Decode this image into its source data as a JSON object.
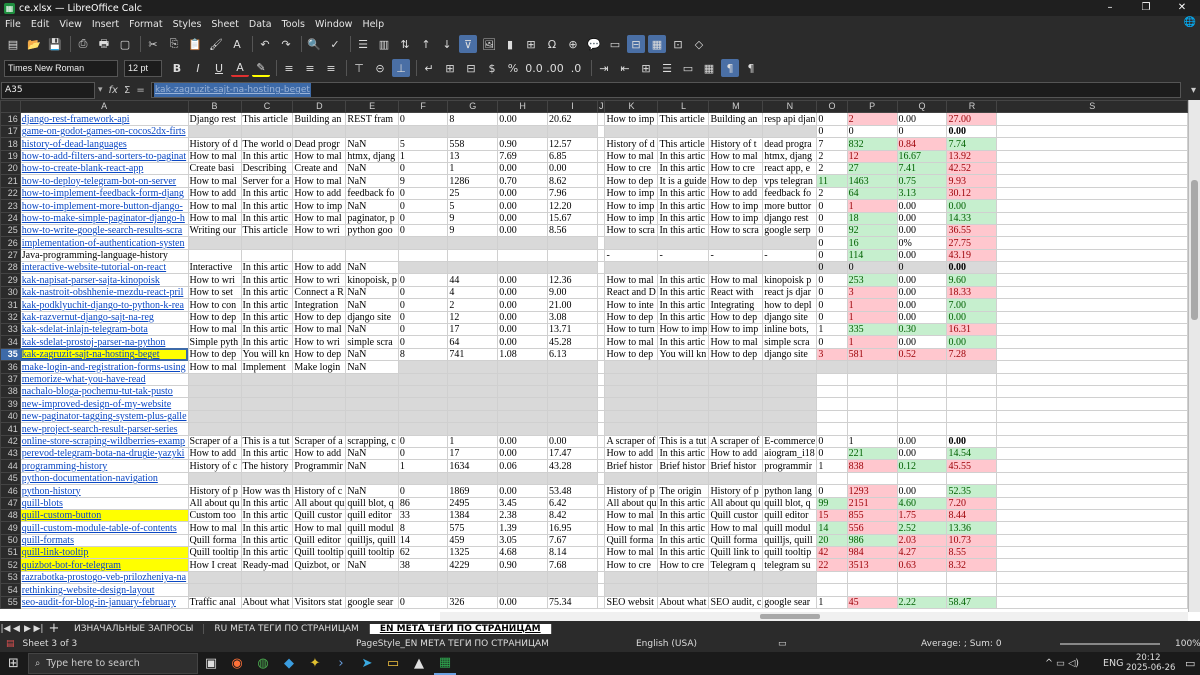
{
  "window": {
    "title": "ce.xlsx — LibreOffice Calc",
    "app_icon": "calc-icon",
    "controls": [
      "–",
      "❐",
      "✕"
    ]
  },
  "menu": [
    "File",
    "Edit",
    "View",
    "Insert",
    "Format",
    "Styles",
    "Sheet",
    "Data",
    "Tools",
    "Window",
    "Help"
  ],
  "formatting": {
    "font_name": "Times New Roman",
    "font_size": "12 pt"
  },
  "formula": {
    "name_box": "A35",
    "content": "kak-zagruzit-sajt-na-hosting-beget",
    "fx": "fx",
    "sum": "Σ",
    "eq": "="
  },
  "columns": [
    "A",
    "B",
    "C",
    "D",
    "E",
    "F",
    "G",
    "H",
    "I",
    "J",
    "K",
    "L",
    "M",
    "N",
    "O",
    "P",
    "Q",
    "R",
    "S"
  ],
  "selected_row": "35",
  "rows": [
    {
      "n": "16",
      "A": "django-rest-framework-api",
      "B": "Django rest",
      "C": "This article",
      "D": "Building an",
      "E": "REST fram",
      "F": "0",
      "G": "8",
      "H": "0.00",
      "I": "20.62",
      "K": "How to imp",
      "L": "This article",
      "M": "Building an",
      "N": "resp api djan",
      "O": "0",
      "P": "2",
      "Q": "0.00",
      "R": "27.00",
      "Pc": "pink",
      "Rc": "pink"
    },
    {
      "n": "17",
      "A": "game-on-godot-games-on-cocos2dx-firts",
      "grey": true,
      "O": "0",
      "P": "0",
      "Q": "0",
      "R": "0.00",
      "Rc": "bold"
    },
    {
      "n": "18",
      "A": "history-of-dead-languages",
      "B": "History of d",
      "C": "The world o",
      "D": "Dead progr",
      "E": "NaN",
      "F": "5",
      "G": "558",
      "H": "0.90",
      "I": "12.57",
      "K": "History of d",
      "L": "This article",
      "M": "History of t",
      "N": "dead progra",
      "O": "7",
      "P": "832",
      "Q": "0.84",
      "R": "7.74",
      "Pc": "green",
      "Qc": "pink",
      "Rc": "green"
    },
    {
      "n": "19",
      "A": "how-to-add-filters-and-sorters-to-paginat",
      "B": "How to mal",
      "C": "In this artic",
      "D": "How to mal",
      "E": "htmx, djang",
      "F": "1",
      "G": "13",
      "H": "7.69",
      "I": "6.85",
      "K": "How to mal",
      "L": "In this artic",
      "M": "How to mal",
      "N": "htmx, djang",
      "O": "2",
      "P": "12",
      "Q": "16.67",
      "R": "13.92",
      "Pc": "pink",
      "Qc": "green",
      "Rc": "pink"
    },
    {
      "n": "20",
      "A": "how-to-create-blank-react-app",
      "B": "Create basi",
      "C": "Describing",
      "D": "Create and",
      "E": "NaN",
      "F": "0",
      "G": "1",
      "H": "0.00",
      "I": "0.00",
      "K": "How to cre",
      "L": "In this artic",
      "M": "How to cre",
      "N": "react app, e",
      "O": "2",
      "P": "27",
      "Q": "7.41",
      "R": "42.52",
      "Pc": "green",
      "Qc": "green",
      "Rc": "pink"
    },
    {
      "n": "21",
      "A": "how-to-deploy-telegram-bot-on-server",
      "B": "How to mal",
      "C": "Server for a",
      "D": "How to mal",
      "E": "NaN",
      "F": "9",
      "G": "1286",
      "H": "0.70",
      "I": "8.62",
      "K": "How to dep",
      "L": "It is a guide",
      "M": "How to dep",
      "N": "vps telegran",
      "O": "11",
      "P": "1463",
      "Q": "0.75",
      "R": "9.93",
      "Oc": "green",
      "Pc": "green",
      "Qc": "green",
      "Rc": "pink"
    },
    {
      "n": "22",
      "A": "how-to-implement-feedback-form-djang",
      "B": "How to add",
      "C": "In this artic",
      "D": "How to add",
      "E": "feedback fo",
      "F": "0",
      "G": "25",
      "H": "0.00",
      "I": "7.96",
      "K": "How to imp",
      "L": "In this artic",
      "M": "How to add",
      "N": "feedback fo",
      "O": "2",
      "P": "64",
      "Q": "3.13",
      "R": "30.12",
      "Pc": "green",
      "Qc": "green",
      "Rc": "pink"
    },
    {
      "n": "23",
      "A": "how-to-implement-more-button-django-",
      "B": "How to mal",
      "C": "In this artic",
      "D": "How to imp",
      "E": "NaN",
      "F": "0",
      "G": "5",
      "H": "0.00",
      "I": "12.20",
      "K": "How to imp",
      "L": "In this artic",
      "M": "How to imp",
      "N": "more buttor",
      "O": "0",
      "P": "1",
      "Q": "0.00",
      "R": "0.00",
      "Pc": "pink",
      "Rc": "green"
    },
    {
      "n": "24",
      "A": "how-to-make-simple-paginator-django-h",
      "B": "How to mal",
      "C": "In this artic",
      "D": "How to mal",
      "E": "paginator, p",
      "F": "0",
      "G": "9",
      "H": "0.00",
      "I": "15.67",
      "K": "How to imp",
      "L": "In this artic",
      "M": "How to imp",
      "N": "django rest",
      "O": "0",
      "P": "18",
      "Q": "0.00",
      "R": "14.33",
      "Pc": "green",
      "Rc": "green"
    },
    {
      "n": "25",
      "A": "how-to-write-google-search-results-scra",
      "B": "Writing our",
      "C": "This article",
      "D": "How to wri",
      "E": "python goo",
      "F": "0",
      "G": "9",
      "H": "0.00",
      "I": "8.56",
      "K": "How to scra",
      "L": "In this artic",
      "M": "How to scra",
      "N": "google serp",
      "O": "0",
      "P": "92",
      "Q": "0.00",
      "R": "36.55",
      "Pc": "green",
      "Rc": "pink"
    },
    {
      "n": "26",
      "A": "implementation-of-authentication-systen",
      "grey": true,
      "O": "0",
      "P": "16",
      "Q": "0%",
      "R": "27.75",
      "Pc": "green",
      "Rc": "pink"
    },
    {
      "n": "27",
      "A": "Java-programming-language-history",
      "plain": true,
      "K": "-",
      "L": "-",
      "M": "-",
      "N": "-",
      "O": "0",
      "P": "114",
      "Q": "0.00",
      "R": "43.19",
      "Pc": "green",
      "Rc": "pink"
    },
    {
      "n": "28",
      "A": "interactive-website-tutorial-on-react",
      "B": "Interactive",
      "C": "In this artic",
      "D": "How to add",
      "E": "NaN",
      "grey2": true,
      "O": "0",
      "P": "0",
      "Q": "0",
      "R": "0.00",
      "Rc": "bold"
    },
    {
      "n": "29",
      "A": "kak-napisat-parser-sajta-kinopoisk",
      "B": "How to wri",
      "C": "In this artic",
      "D": "How to wri",
      "E": "kinopoisk, p",
      "F": "0",
      "G": "44",
      "H": "0.00",
      "I": "12.36",
      "K": "How to mal",
      "L": "In this artic",
      "M": "How to mal",
      "N": "kinopoisk p",
      "O": "0",
      "P": "253",
      "Q": "0.00",
      "R": "9.60",
      "Pc": "green",
      "Rc": "green"
    },
    {
      "n": "30",
      "A": "kak-nastroit-obshhenie-mezdu-react-pril",
      "B": "How to set",
      "C": "In this artic",
      "D": "Connect a R",
      "E": "NaN",
      "F": "0",
      "G": "4",
      "H": "0.00",
      "I": "9.00",
      "K": "React and D",
      "L": "In this artic",
      "M": "React with",
      "N": "react js djar",
      "O": "0",
      "P": "3",
      "Q": "0.00",
      "R": "18.33",
      "Pc": "pink",
      "Rc": "pink"
    },
    {
      "n": "31",
      "A": "kak-podklyuchit-django-to-python-k-rea",
      "B": "How to con",
      "C": "In this artic",
      "D": "Integration",
      "E": "NaN",
      "F": "0",
      "G": "2",
      "H": "0.00",
      "I": "21.00",
      "K": "How to inte",
      "L": "In this artic",
      "M": "Integrating",
      "N": "how to depl",
      "O": "0",
      "P": "1",
      "Q": "0.00",
      "R": "7.00",
      "Pc": "pink",
      "Rc": "green"
    },
    {
      "n": "32",
      "A": "kak-razvernut-django-sajt-na-reg",
      "B": "How to dep",
      "C": "In this artic",
      "D": "How to dep",
      "E": "django site",
      "F": "0",
      "G": "12",
      "H": "0.00",
      "I": "3.08",
      "K": "How to dep",
      "L": "In this artic",
      "M": "How to dep",
      "N": "django site",
      "O": "0",
      "P": "1",
      "Q": "0.00",
      "R": "0.00",
      "Pc": "pink",
      "Rc": "green"
    },
    {
      "n": "33",
      "A": "kak-sdelat-inlajn-telegram-bota",
      "B": "How to mal",
      "C": "In this artic",
      "D": "How to mal",
      "E": "NaN",
      "F": "0",
      "G": "17",
      "H": "0.00",
      "I": "13.71",
      "K": "How to turn",
      "L": "How to imp",
      "M": "How to imp",
      "N": "inline bots,",
      "O": "1",
      "P": "335",
      "Q": "0.30",
      "R": "16.31",
      "Pc": "green",
      "Qc": "green",
      "Rc": "pink"
    },
    {
      "n": "34",
      "A": "kak-sdelat-prostoj-parser-na-python",
      "B": "Simple pyth",
      "C": "In this artic",
      "D": "How to wri",
      "E": "simple scra",
      "F": "0",
      "G": "64",
      "H": "0.00",
      "I": "45.28",
      "K": "How to mal",
      "L": "In this artic",
      "M": "How to mal",
      "N": "simple scra",
      "O": "0",
      "P": "1",
      "Q": "0.00",
      "R": "0.00",
      "Pc": "pink",
      "Rc": "green"
    },
    {
      "n": "35",
      "A": "kak-zagruzit-sajt-na-hosting-beget",
      "yel": true,
      "B": "How to dep",
      "C": "You will kn",
      "D": "How to dep",
      "E": "NaN",
      "F": "8",
      "G": "741",
      "H": "1.08",
      "I": "6.13",
      "K": "How to dep",
      "L": "You will kn",
      "M": "How to dep",
      "N": "django site",
      "O": "3",
      "P": "581",
      "Q": "0.52",
      "R": "7.28",
      "Oc": "pink",
      "Pc": "pink",
      "Qc": "pink",
      "Rc": "pink"
    },
    {
      "n": "36",
      "A": "make-login-and-registration-forms-using",
      "B": "How to mal",
      "C": "Implement",
      "D": "Make login",
      "E": "NaN",
      "grey2": true
    },
    {
      "n": "37",
      "A": "memorize-what-you-have-read",
      "grey": true
    },
    {
      "n": "38",
      "A": "nachalo-bloga-pochemu-tut-tak-pusto",
      "grey": true
    },
    {
      "n": "39",
      "A": "new-improved-design-of-my-website",
      "grey": true
    },
    {
      "n": "40",
      "A": "new-paginator-tagging-system-plus-galle",
      "grey": true
    },
    {
      "n": "41",
      "A": "new-project-search-result-parser-series",
      "grey": true
    },
    {
      "n": "42",
      "A": "online-store-scraping-wildberries-examp",
      "B": "Scraper of a",
      "C": "This is a tut",
      "D": "Scraper of a",
      "E": "scrapping, c",
      "F": "0",
      "G": "1",
      "H": "0.00",
      "I": "0.00",
      "K": "A scraper of",
      "L": "This is a tut",
      "M": "A scraper of",
      "N": "E-commerce",
      "O": "0",
      "P": "1",
      "Q": "0.00",
      "R": "0.00",
      "Rc": "bold"
    },
    {
      "n": "43",
      "A": "perevod-telegram-bota-na-drugie-yazyki",
      "B": "How to add",
      "C": "In this artic",
      "D": "How to add",
      "E": "NaN",
      "F": "0",
      "G": "17",
      "H": "0.00",
      "I": "17.47",
      "K": "How to add",
      "L": "In this artic",
      "M": "How to add",
      "N": "aiogram_i18",
      "O": "0",
      "P": "221",
      "Q": "0.00",
      "R": "14.54",
      "Pc": "green",
      "Rc": "green"
    },
    {
      "n": "44",
      "A": "programming-history",
      "B": "History of c",
      "C": "The history",
      "D": "Programmir",
      "E": "NaN",
      "F": "1",
      "G": "1634",
      "H": "0.06",
      "I": "43.28",
      "K": "Brief histor",
      "L": "Brief histor",
      "M": "Brief histor",
      "N": "programmir",
      "O": "1",
      "P": "838",
      "Q": "0.12",
      "R": "45.55",
      "Pc": "pink",
      "Qc": "green",
      "Rc": "pink"
    },
    {
      "n": "45",
      "A": "python-documentation-navigation",
      "grey": true
    },
    {
      "n": "46",
      "A": "python-history",
      "B": "History of p",
      "C": "How was th",
      "D": "History of c",
      "E": "NaN",
      "F": "0",
      "G": "1869",
      "H": "0.00",
      "I": "53.48",
      "K": "History of p",
      "L": "The origin",
      "M": "History of p",
      "N": "python lang",
      "O": "0",
      "P": "1293",
      "Q": "0.00",
      "R": "52.35",
      "Pc": "pink",
      "Rc": "green"
    },
    {
      "n": "47",
      "A": "quill-blots",
      "B": "All about qu",
      "C": "In this artic",
      "D": "All about qu",
      "E": "quill blot, q",
      "F": "86",
      "G": "2495",
      "H": "3.45",
      "I": "6.42",
      "K": "All about qu",
      "L": "In this artic",
      "M": "All about qu",
      "N": "quill blot, q",
      "O": "99",
      "P": "2151",
      "Q": "4.60",
      "R": "7.20",
      "Oc": "green",
      "Pc": "pink",
      "Qc": "green",
      "Rc": "pink"
    },
    {
      "n": "48",
      "A": "quill-custom-button",
      "yel": true,
      "B": "Custom too",
      "C": "In this artic",
      "D": "Quill custor",
      "E": "quill editor",
      "F": "33",
      "G": "1384",
      "H": "2.38",
      "I": "8.42",
      "K": "How to mal",
      "L": "In this artic",
      "M": "Quill custor",
      "N": "quill editor",
      "O": "15",
      "P": "855",
      "Q": "1.75",
      "R": "8.44",
      "Oc": "pink",
      "Pc": "pink",
      "Qc": "pink",
      "Rc": "pink"
    },
    {
      "n": "49",
      "A": "quill-custom-module-table-of-contents",
      "B": "How to mal",
      "C": "In this artic",
      "D": "How to mal",
      "E": "quill modul",
      "F": "8",
      "G": "575",
      "H": "1.39",
      "I": "16.95",
      "K": "How to mal",
      "L": "In this artic",
      "M": "How to mal",
      "N": "quill modul",
      "O": "14",
      "P": "556",
      "Q": "2.52",
      "R": "13.36",
      "Oc": "green",
      "Pc": "pink",
      "Qc": "green",
      "Rc": "green"
    },
    {
      "n": "50",
      "A": "quill-formats",
      "B": "Quill forma",
      "C": "In this artic",
      "D": "Quill editor",
      "E": "quilljs, quill",
      "F": "14",
      "G": "459",
      "H": "3.05",
      "I": "7.67",
      "K": "Quill forma",
      "L": "In this artic",
      "M": "Quill forma",
      "N": "quilljs, quill",
      "O": "20",
      "P": "986",
      "Q": "2.03",
      "R": "10.73",
      "Oc": "green",
      "Pc": "green",
      "Qc": "pink",
      "Rc": "pink"
    },
    {
      "n": "51",
      "A": "quill-link-tooltip",
      "yel": true,
      "B": "Quill tooltip",
      "C": "In this artic",
      "D": "Quill tooltip",
      "E": "quill tooltip",
      "F": "62",
      "G": "1325",
      "H": "4.68",
      "I": "8.14",
      "K": "How to mal",
      "L": "In this artic",
      "M": "Quill link to",
      "N": "quill tooltip",
      "O": "42",
      "P": "984",
      "Q": "4.27",
      "R": "8.55",
      "Oc": "pink",
      "Pc": "pink",
      "Qc": "pink",
      "Rc": "pink"
    },
    {
      "n": "52",
      "A": "quizbot-bot-for-telegram",
      "yel": true,
      "B": "How I creat",
      "C": "Ready-mad",
      "D": "Quizbot, or",
      "E": "NaN",
      "F": "38",
      "G": "4229",
      "H": "0.90",
      "I": "7.68",
      "K": "How to cre",
      "L": "How to cre",
      "M": "Telegram q",
      "N": "telegram su",
      "O": "22",
      "P": "3513",
      "Q": "0.63",
      "R": "8.32",
      "Oc": "pink",
      "Pc": "pink",
      "Qc": "pink",
      "Rc": "pink"
    },
    {
      "n": "53",
      "A": "razrabotka-prostogo-veb-prilozheniya-na",
      "grey": true
    },
    {
      "n": "54",
      "A": "rethinking-website-design-layout",
      "grey": true
    },
    {
      "n": "55",
      "A": "seo-audit-for-blog-in-january-february",
      "B": "Traffic anal",
      "C": "About what",
      "D": "Visitors stat",
      "E": "google sear",
      "F": "0",
      "G": "326",
      "H": "0.00",
      "I": "75.34",
      "K": "SEO websit",
      "L": "About what",
      "M": "SEO audit, c",
      "N": "google sear",
      "O": "1",
      "P": "45",
      "Q": "2.22",
      "R": "58.47",
      "Pc": "pink",
      "Qc": "green",
      "Rc": "green"
    }
  ],
  "sheet_tabs": [
    "ИЗНАЧАЛЬНЫЕ ЗАПРОСЫ",
    "RU МЕТА ТЕГИ ПО СТРАНИЦАМ",
    "EN МЕТА ТЕГИ ПО СТРАНИЦАМ"
  ],
  "active_tab": 2,
  "status": {
    "sheet": "Sheet 3 of 3",
    "page_style": "PageStyle_EN МЕТА ТЕГИ ПО СТРАНИЦАМ",
    "language": "English (USA)",
    "summary": "Average: ; Sum: 0",
    "zoom": "100%"
  },
  "taskbar": {
    "search_placeholder": "Type here to search",
    "lang": "ENG",
    "time": "20:12",
    "date": "2025-06-26"
  }
}
